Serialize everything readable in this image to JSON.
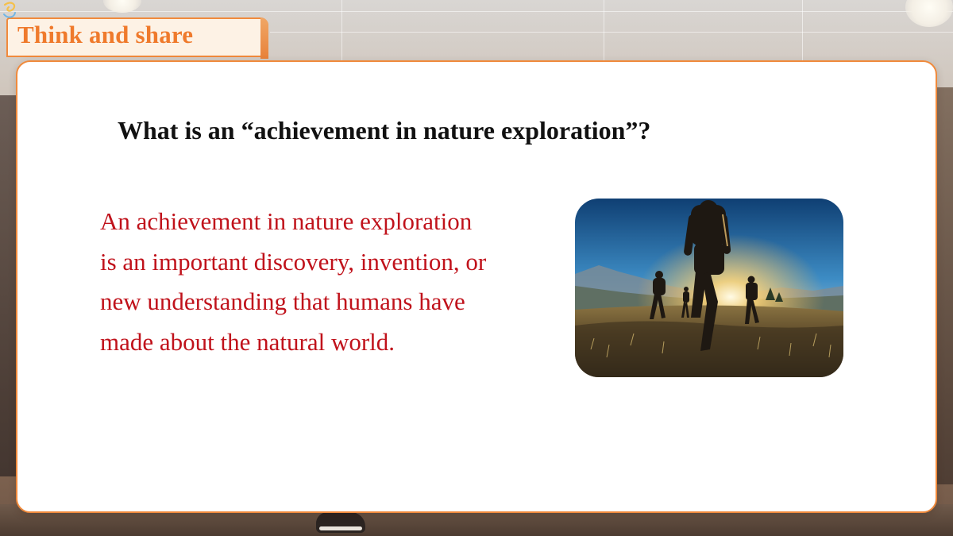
{
  "header": {
    "title": "Think and share"
  },
  "main": {
    "question": "What is an “achievement in nature exploration”?",
    "answer_lines": [
      "An achievement in nature exploration",
      "is an important discovery, invention, or",
      "new understanding that humans have",
      "made about the natural world."
    ]
  },
  "colors": {
    "accent": "#f08a3c",
    "title_text": "#ef7a2c",
    "answer_text": "#c0121b",
    "question_text": "#111111"
  },
  "icons": {
    "title_decoration": "swirl-icon"
  }
}
